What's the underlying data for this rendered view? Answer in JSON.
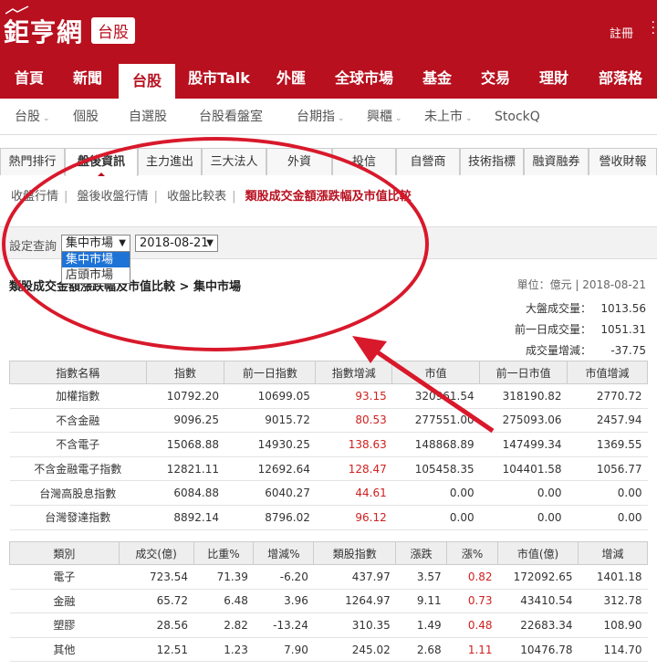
{
  "header": {
    "logo_text": "鉅亨網",
    "badge": "台股",
    "register": "註冊"
  },
  "nav_main": [
    {
      "label": "首頁"
    },
    {
      "label": "新聞"
    },
    {
      "label": "台股"
    },
    {
      "label": "股市Talk"
    },
    {
      "label": "外匯"
    },
    {
      "label": "全球市場"
    },
    {
      "label": "基金"
    },
    {
      "label": "交易"
    },
    {
      "label": "理財"
    },
    {
      "label": "部落格"
    }
  ],
  "nav_sub": [
    {
      "label": "台股"
    },
    {
      "label": "個股"
    },
    {
      "label": "自選股"
    },
    {
      "label": "台股看盤室"
    },
    {
      "label": "台期指"
    },
    {
      "label": "興櫃"
    },
    {
      "label": "未上市"
    },
    {
      "label": "StockQ"
    }
  ],
  "tabs": [
    {
      "label": "熱門排行"
    },
    {
      "label": "盤後資訊"
    },
    {
      "label": "主力進出"
    },
    {
      "label": "三大法人"
    },
    {
      "label": "外資"
    },
    {
      "label": "投信"
    },
    {
      "label": "自營商"
    },
    {
      "label": "技術指標"
    },
    {
      "label": "融資融券"
    },
    {
      "label": "營收財報"
    }
  ],
  "subnav": [
    "收盤行情",
    "盤後收盤行情",
    "收盤比較表",
    "類股成交金額漲跌幅及市值比較"
  ],
  "query": {
    "label": "設定查詢",
    "market": "集中市場",
    "date": "2018-08-21",
    "options": [
      "集中市場",
      "店頭市場"
    ]
  },
  "title": "類股成交金額漲跌幅及市值比較 > 集中市場",
  "unit": "單位：億元 | 2018-08-21",
  "summary": [
    {
      "label": "大盤成交量：",
      "value": "1013.56"
    },
    {
      "label": "前一日成交量：",
      "value": "1051.31"
    },
    {
      "label": "成交量增減：",
      "value": "-37.75"
    }
  ],
  "index_table": {
    "headers": [
      "指數名稱",
      "指數",
      "前一日指數",
      "指數增減",
      "市值",
      "前一日市值",
      "市值增減"
    ],
    "rows": [
      [
        "加權指數",
        "10792.20",
        "10699.05",
        "93.15",
        "320961.54",
        "318190.82",
        "2770.72"
      ],
      [
        "不含金融",
        "9096.25",
        "9015.72",
        "80.53",
        "277551.00",
        "275093.06",
        "2457.94"
      ],
      [
        "不含電子",
        "15068.88",
        "14930.25",
        "138.63",
        "148868.89",
        "147499.34",
        "1369.55"
      ],
      [
        "不含金融電子指數",
        "12821.11",
        "12692.64",
        "128.47",
        "105458.35",
        "104401.58",
        "1056.77"
      ],
      [
        "台灣高股息指數",
        "6084.88",
        "6040.27",
        "44.61",
        "0.00",
        "0.00",
        "0.00"
      ],
      [
        "台灣發達指數",
        "8892.14",
        "8796.02",
        "96.12",
        "0.00",
        "0.00",
        "0.00"
      ]
    ]
  },
  "sector_table": {
    "headers": [
      "類別",
      "成交(億)",
      "比重%",
      "增減%",
      "類股指數",
      "漲跌",
      "漲%",
      "市值(億)",
      "增減"
    ],
    "rows": [
      [
        "電子",
        "723.54",
        "71.39",
        "-6.20",
        "437.97",
        "3.57",
        "0.82",
        "172092.65",
        "1401.18"
      ],
      [
        "金融",
        "65.72",
        "6.48",
        "3.96",
        "1264.97",
        "9.11",
        "0.73",
        "43410.54",
        "312.78"
      ],
      [
        "塑膠",
        "28.56",
        "2.82",
        "-13.24",
        "310.35",
        "1.49",
        "0.48",
        "22683.34",
        "108.90"
      ],
      [
        "其他",
        "12.51",
        "1.23",
        "7.90",
        "245.02",
        "2.68",
        "1.11",
        "10476.78",
        "114.70"
      ]
    ]
  },
  "colors": {
    "brand": "#b8101f",
    "up": "#d02020",
    "annotation": "#d8192b"
  }
}
